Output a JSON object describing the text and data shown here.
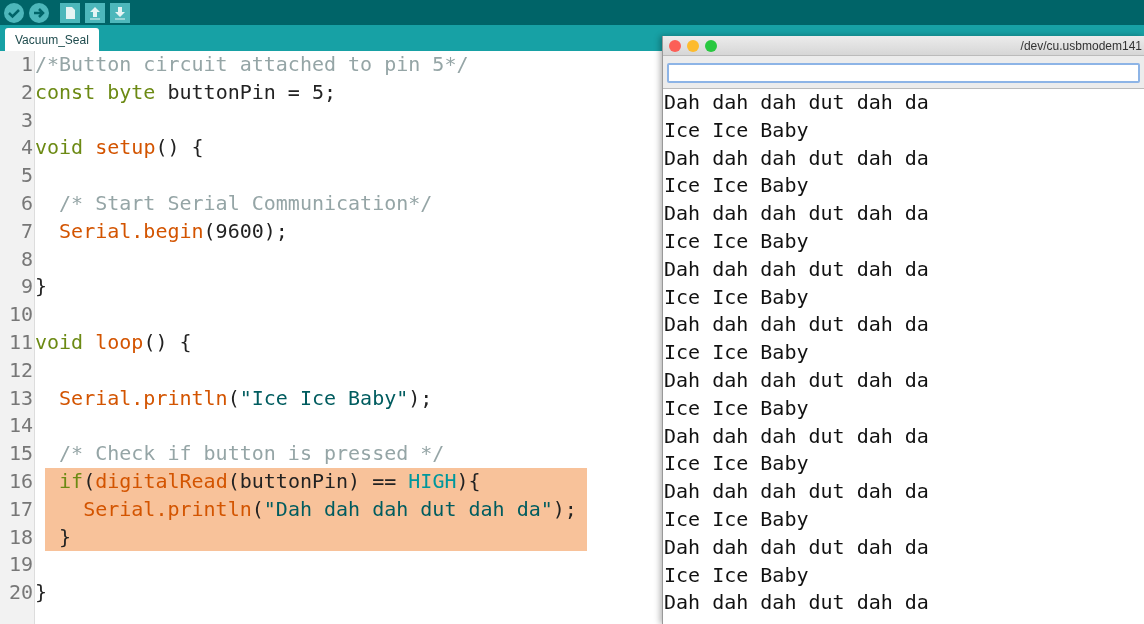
{
  "toolbar": [
    {
      "kind": "verify"
    },
    {
      "kind": "upload"
    },
    {
      "kind": "new"
    },
    {
      "kind": "open"
    },
    {
      "kind": "save"
    }
  ],
  "tabs": [
    {
      "label": "Vacuum_Seal",
      "selected": true
    }
  ],
  "editor": {
    "lines": [
      {
        "number": "1",
        "highlighted": false,
        "tokens": [
          {
            "kind": "comment",
            "text": "/*Button circuit attached to pin 5*/"
          }
        ]
      },
      {
        "number": "2",
        "highlighted": false,
        "tokens": [
          {
            "kind": "keyword",
            "text": "const byte"
          },
          {
            "kind": "plain",
            "text": " buttonPin = 5;"
          }
        ]
      },
      {
        "number": "3",
        "highlighted": false
      },
      {
        "number": "4",
        "highlighted": false,
        "tokens": [
          {
            "kind": "keyword",
            "text": "void"
          },
          {
            "kind": "function",
            "text": " setup"
          },
          {
            "kind": "plain",
            "text": "() {"
          }
        ]
      },
      {
        "number": "5",
        "highlighted": false
      },
      {
        "number": "6",
        "highlighted": false,
        "tokens": [
          {
            "kind": "comment",
            "text": "  /* Start Serial Communication*/"
          }
        ]
      },
      {
        "number": "7",
        "highlighted": false,
        "tokens": [
          {
            "kind": "function",
            "text": "  Serial.begin"
          },
          {
            "kind": "plain",
            "text": "(9600);"
          }
        ]
      },
      {
        "number": "8",
        "highlighted": false
      },
      {
        "number": "9",
        "highlighted": false,
        "tokens": [
          {
            "kind": "plain",
            "text": "}"
          }
        ]
      },
      {
        "number": "10",
        "highlighted": false
      },
      {
        "number": "11",
        "highlighted": false,
        "tokens": [
          {
            "kind": "keyword",
            "text": "void"
          },
          {
            "kind": "function",
            "text": " loop"
          },
          {
            "kind": "plain",
            "text": "() {"
          }
        ]
      },
      {
        "number": "12",
        "highlighted": false
      },
      {
        "number": "13",
        "highlighted": false,
        "tokens": [
          {
            "kind": "function",
            "text": "  Serial.println"
          },
          {
            "kind": "plain",
            "text": "("
          },
          {
            "kind": "string",
            "text": "\"Ice Ice Baby\""
          },
          {
            "kind": "plain",
            "text": ");"
          }
        ]
      },
      {
        "number": "14",
        "highlighted": false
      },
      {
        "number": "15",
        "highlighted": false,
        "tokens": [
          {
            "kind": "comment",
            "text": "  /* Check if button is pressed */"
          }
        ]
      },
      {
        "number": "16",
        "highlighted": true,
        "tokens": [
          {
            "kind": "keyword",
            "text": "  if"
          },
          {
            "kind": "plain",
            "text": "("
          },
          {
            "kind": "function",
            "text": "digitalRead"
          },
          {
            "kind": "plain",
            "text": "(buttonPin) == "
          },
          {
            "kind": "constant",
            "text": "HIGH"
          },
          {
            "kind": "plain",
            "text": "){"
          }
        ]
      },
      {
        "number": "17",
        "highlighted": true,
        "tokens": [
          {
            "kind": "function",
            "text": "    Serial.println"
          },
          {
            "kind": "plain",
            "text": "("
          },
          {
            "kind": "string",
            "text": "\"Dah dah dah dut dah da\""
          },
          {
            "kind": "plain",
            "text": ");"
          }
        ]
      },
      {
        "number": "18",
        "highlighted": true,
        "tokens": [
          {
            "kind": "plain",
            "text": "  }"
          }
        ]
      },
      {
        "number": "19",
        "highlighted": false
      },
      {
        "number": "20",
        "highlighted": false,
        "tokens": [
          {
            "kind": "plain",
            "text": "}"
          }
        ]
      }
    ]
  },
  "serial_monitor": {
    "title": "/dev/cu.usbmodem141",
    "output": [
      "Dah dah dah dut dah da",
      "Ice Ice Baby",
      "Dah dah dah dut dah da",
      "Ice Ice Baby",
      "Dah dah dah dut dah da",
      "Ice Ice Baby",
      "Dah dah dah dut dah da",
      "Ice Ice Baby",
      "Dah dah dah dut dah da",
      "Ice Ice Baby",
      "Dah dah dah dut dah da",
      "Ice Ice Baby",
      "Dah dah dah dut dah da",
      "Ice Ice Baby",
      "Dah dah dah dut dah da",
      "Ice Ice Baby",
      "Dah dah dah dut dah da",
      "Ice Ice Baby",
      "Dah dah dah dut dah da"
    ]
  }
}
